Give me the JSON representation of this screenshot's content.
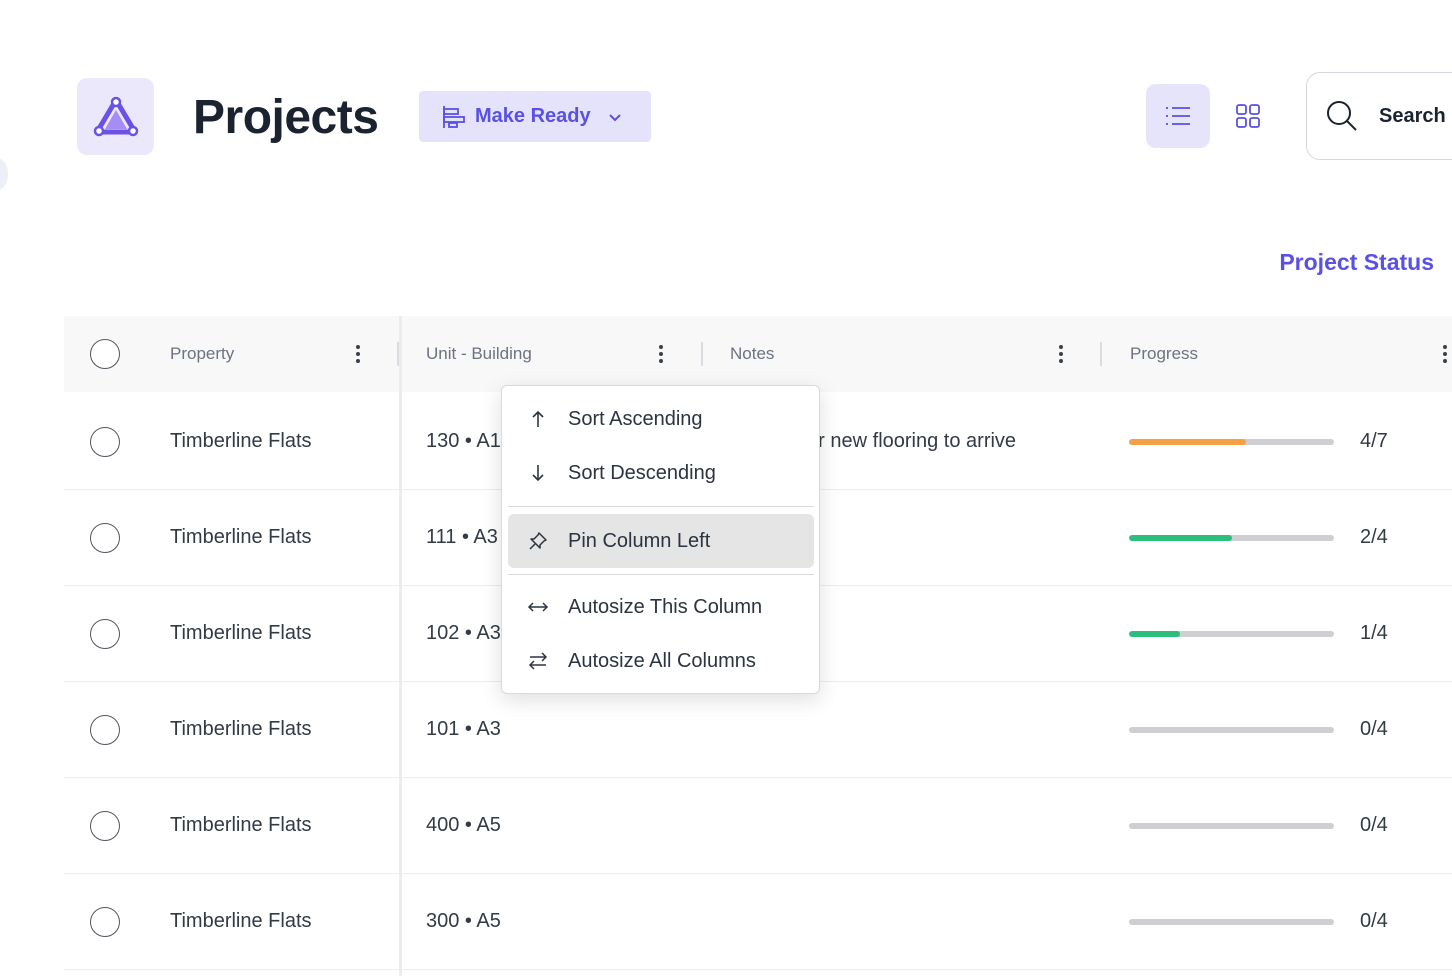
{
  "header": {
    "logo_icon": "triangle-logo-icon",
    "title": "Projects",
    "view_selector": {
      "label": "Make Ready",
      "icon": "gantt-icon",
      "chevron": "chevron-down-icon"
    },
    "list_view_icon": "list-icon",
    "grid_view_icon": "grid-icon",
    "search": {
      "label": "Search",
      "icon": "search-icon"
    }
  },
  "project_status_link": "Project Status",
  "colors": {
    "accent": "#5a50e6",
    "accent_bg": "#e4e3fb",
    "progress_orange": "#f5a045",
    "progress_green": "#2dbe7e",
    "progress_track": "#cdcfd3"
  },
  "table": {
    "columns": [
      {
        "label": "Property"
      },
      {
        "label": "Unit - Building"
      },
      {
        "label": "Notes"
      },
      {
        "label": "Progress"
      }
    ],
    "rows": [
      {
        "property": "Timberline Flats",
        "unit": "130 • A1",
        "notes": "Waiting for new flooring to arrive",
        "progress": "4/7",
        "fraction": 0.571,
        "color": "#f5a045"
      },
      {
        "property": "Timberline Flats",
        "unit": "111 • A3",
        "notes": "",
        "progress": "2/4",
        "fraction": 0.5,
        "color": "#2dbe7e"
      },
      {
        "property": "Timberline Flats",
        "unit": "102 • A3",
        "notes": "",
        "progress": "1/4",
        "fraction": 0.25,
        "color": "#2dbe7e"
      },
      {
        "property": "Timberline Flats",
        "unit": "101 • A3",
        "notes": "",
        "progress": "0/4",
        "fraction": 0,
        "color": "#2dbe7e"
      },
      {
        "property": "Timberline Flats",
        "unit": "400 • A5",
        "notes": "",
        "progress": "0/4",
        "fraction": 0,
        "color": "#2dbe7e"
      },
      {
        "property": "Timberline Flats",
        "unit": "300 • A5",
        "notes": "",
        "progress": "0/4",
        "fraction": 0,
        "color": "#2dbe7e"
      }
    ]
  },
  "column_menu": {
    "items": [
      {
        "label": "Sort Ascending",
        "icon": "arrow-up-icon"
      },
      {
        "label": "Sort Descending",
        "icon": "arrow-down-icon"
      },
      {
        "label": "Pin Column Left",
        "icon": "pin-icon"
      },
      {
        "label": "Autosize This Column",
        "icon": "arrows-horizontal-icon"
      },
      {
        "label": "Autosize All Columns",
        "icon": "arrows-swap-icon"
      }
    ]
  }
}
